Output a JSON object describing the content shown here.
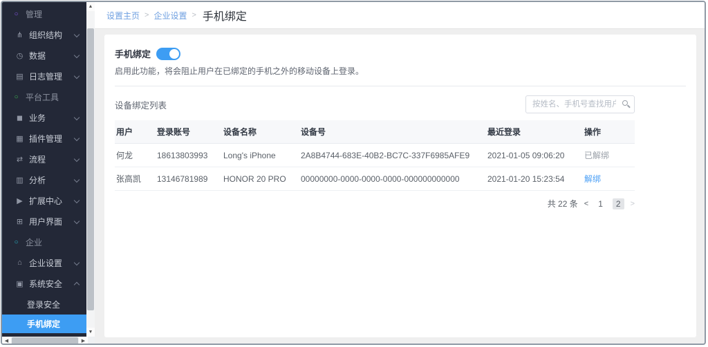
{
  "colors": {
    "sidebar_bg": "#232837",
    "sidebar_active_bg": "#3d9df3",
    "accent_blue": "#3d9df3",
    "link_blue": "#4a9ff5",
    "breadcrumb_link": "#6e9fe0",
    "section_dot_purple": "#8a57f0",
    "section_dot_green": "#3fbf53",
    "section_dot_cyan": "#27b8cc"
  },
  "sidebar": {
    "items": [
      {
        "label": "管理",
        "type": "section",
        "icon": "circle-icon",
        "glyph": "○"
      },
      {
        "label": "组织结构",
        "type": "item",
        "icon": "org-structure-icon",
        "glyph": "⋔",
        "chevron": "down"
      },
      {
        "label": "数据",
        "type": "item",
        "icon": "clock-icon",
        "glyph": "◷",
        "chevron": "down"
      },
      {
        "label": "日志管理",
        "type": "item",
        "icon": "log-list-icon",
        "glyph": "▤",
        "chevron": "down"
      },
      {
        "label": "平台工具",
        "type": "section",
        "icon": "circle-icon",
        "glyph": "○"
      },
      {
        "label": "业务",
        "type": "item",
        "icon": "business-icon",
        "glyph": "◼",
        "chevron": "down"
      },
      {
        "label": "插件管理",
        "type": "item",
        "icon": "plugin-grid-icon",
        "glyph": "▦",
        "chevron": "down"
      },
      {
        "label": "流程",
        "type": "item",
        "icon": "flow-icon",
        "glyph": "⇄",
        "chevron": "down"
      },
      {
        "label": "分析",
        "type": "item",
        "icon": "analytics-icon",
        "glyph": "▥",
        "chevron": "down"
      },
      {
        "label": "扩展中心",
        "type": "item",
        "icon": "extension-icon",
        "glyph": "▶",
        "chevron": "down"
      },
      {
        "label": "用户界面",
        "type": "item",
        "icon": "ui-grid-icon",
        "glyph": "⊞",
        "chevron": "down"
      },
      {
        "label": "企业",
        "type": "section",
        "icon": "circle-icon",
        "glyph": "○"
      },
      {
        "label": "企业设置",
        "type": "item",
        "icon": "enterprise-settings-icon",
        "glyph": "⌂",
        "chevron": "down"
      },
      {
        "label": "系统安全",
        "type": "item",
        "icon": "lock-icon",
        "glyph": "▣",
        "chevron": "up"
      },
      {
        "label": "登录安全",
        "type": "subitem"
      },
      {
        "label": "手机绑定",
        "type": "subitem",
        "active": true
      }
    ],
    "scroll_glyphs": {
      "up": "▲",
      "down": "▼",
      "left": "◀",
      "right": "▶"
    }
  },
  "breadcrumb": {
    "links": [
      "设置主页",
      "企业设置"
    ],
    "separator": ">",
    "current": "手机绑定"
  },
  "main": {
    "feature_title": "手机绑定",
    "toggle_state": "on",
    "description": "启用此功能，将会阻止用户在已绑定的手机之外的移动设备上登录。",
    "list_title": "设备绑定列表",
    "search_placeholder": "按姓名、手机号查找用户",
    "table": {
      "headers": [
        "用户",
        "登录账号",
        "设备名称",
        "设备号",
        "最近登录",
        "操作"
      ],
      "rows": [
        {
          "user": "何龙",
          "account": "18613803993",
          "device_name": "Long's iPhone",
          "device_id": "2A8B4744-683E-40B2-BC7C-337F6985AFE9",
          "last_login": "2021-01-05 09:06:20",
          "action": "已解绑",
          "action_type": "muted"
        },
        {
          "user": "张高凯",
          "account": "13146781989",
          "device_name": "HONOR 20 PRO",
          "device_id": "00000000-0000-0000-0000-000000000000",
          "last_login": "2021-01-20 15:23:54",
          "action": "解绑",
          "action_type": "link"
        }
      ]
    },
    "pagination": {
      "total_text": "共 22 条",
      "prev": "<",
      "pages": [
        "1",
        "2"
      ],
      "current_page": "2",
      "next": ">"
    }
  }
}
